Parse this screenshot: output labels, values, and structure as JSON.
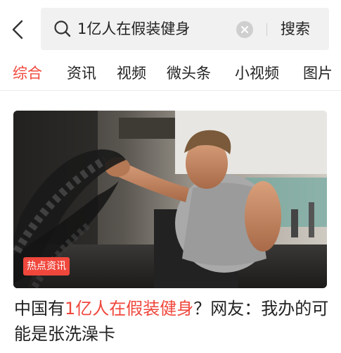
{
  "search": {
    "query": "1亿人在假装健身",
    "button_label": "搜索"
  },
  "tabs": [
    {
      "label": "综合",
      "active": true
    },
    {
      "label": "资讯",
      "active": false
    },
    {
      "label": "视频",
      "active": false
    },
    {
      "label": "微头条",
      "active": false
    },
    {
      "label": "小视频",
      "active": false
    },
    {
      "label": "图片",
      "active": false
    }
  ],
  "article": {
    "badge": "热点资讯",
    "title_pre": "中国有",
    "title_highlight": "1亿人在假装健身",
    "title_post": "？网友：我办的可能是张洗澡卡"
  },
  "colors": {
    "accent": "#f0473c",
    "search_bg": "#f1f1f1"
  },
  "icons": [
    "back-arrow-icon",
    "search-icon",
    "clear-icon"
  ]
}
